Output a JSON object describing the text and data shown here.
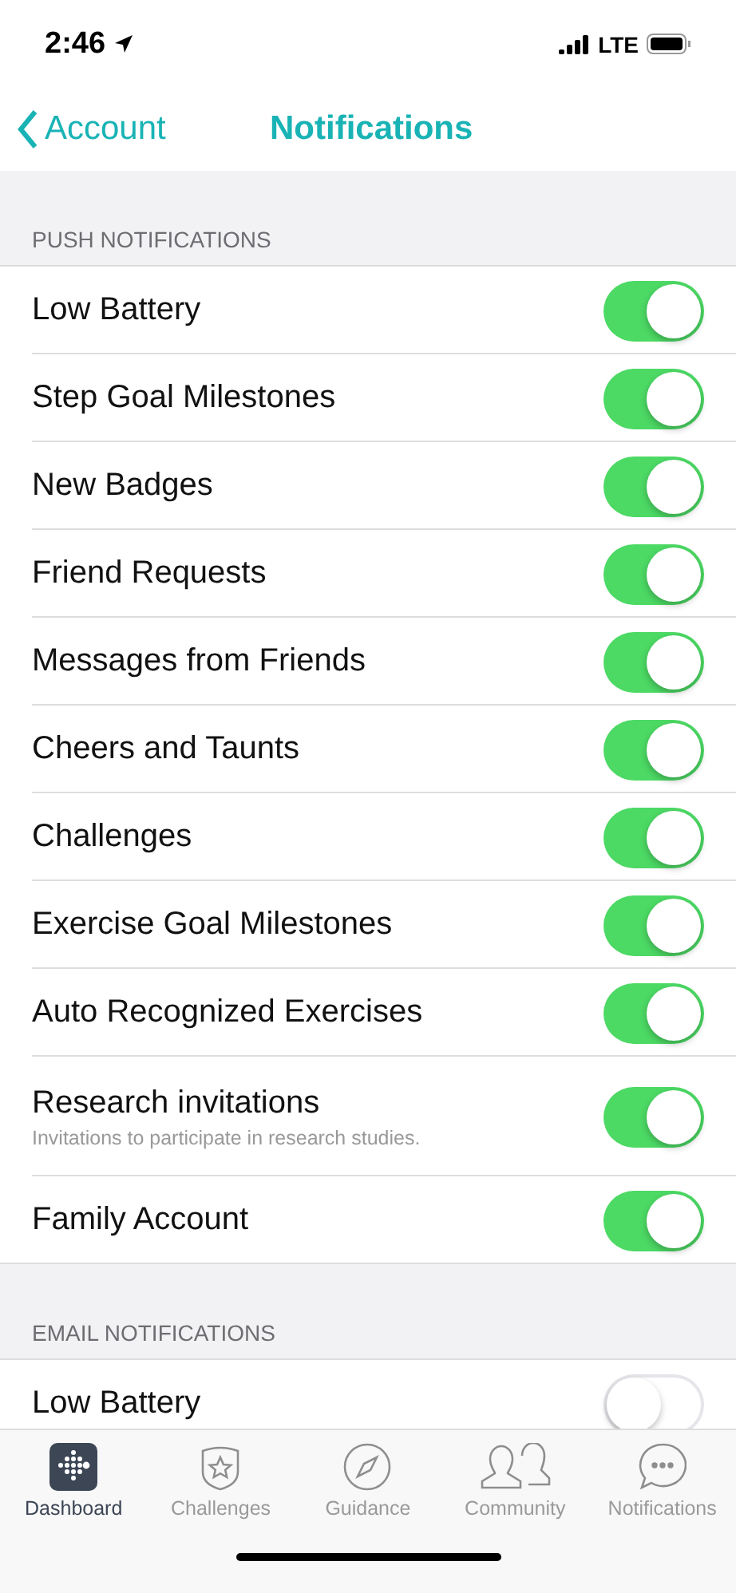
{
  "status_bar": {
    "time": "2:46",
    "network": "LTE"
  },
  "nav": {
    "back": "Account",
    "title": "Notifications"
  },
  "sections": [
    {
      "header": "PUSH NOTIFICATIONS",
      "items": [
        {
          "label": "Low Battery",
          "on": true
        },
        {
          "label": "Step Goal Milestones",
          "on": true
        },
        {
          "label": "New Badges",
          "on": true
        },
        {
          "label": "Friend Requests",
          "on": true
        },
        {
          "label": "Messages from Friends",
          "on": true
        },
        {
          "label": "Cheers and Taunts",
          "on": true
        },
        {
          "label": "Challenges",
          "on": true
        },
        {
          "label": "Exercise Goal Milestones",
          "on": true
        },
        {
          "label": "Auto Recognized Exercises",
          "on": true
        },
        {
          "label": "Research invitations",
          "description": "Invitations to participate in research studies.",
          "on": true
        },
        {
          "label": "Family Account",
          "on": true
        }
      ]
    },
    {
      "header": "EMAIL NOTIFICATIONS",
      "items": [
        {
          "label": "Low Battery",
          "on": false
        }
      ]
    }
  ],
  "tab_bar": [
    {
      "kind": "dashboard",
      "label": "Dashboard",
      "selected": true
    },
    {
      "kind": "challenges",
      "label": "Challenges",
      "selected": false
    },
    {
      "kind": "guidance",
      "label": "Guidance",
      "selected": false
    },
    {
      "kind": "community",
      "label": "Community",
      "selected": false
    },
    {
      "kind": "notifications",
      "label": "Notifications",
      "selected": false
    }
  ]
}
